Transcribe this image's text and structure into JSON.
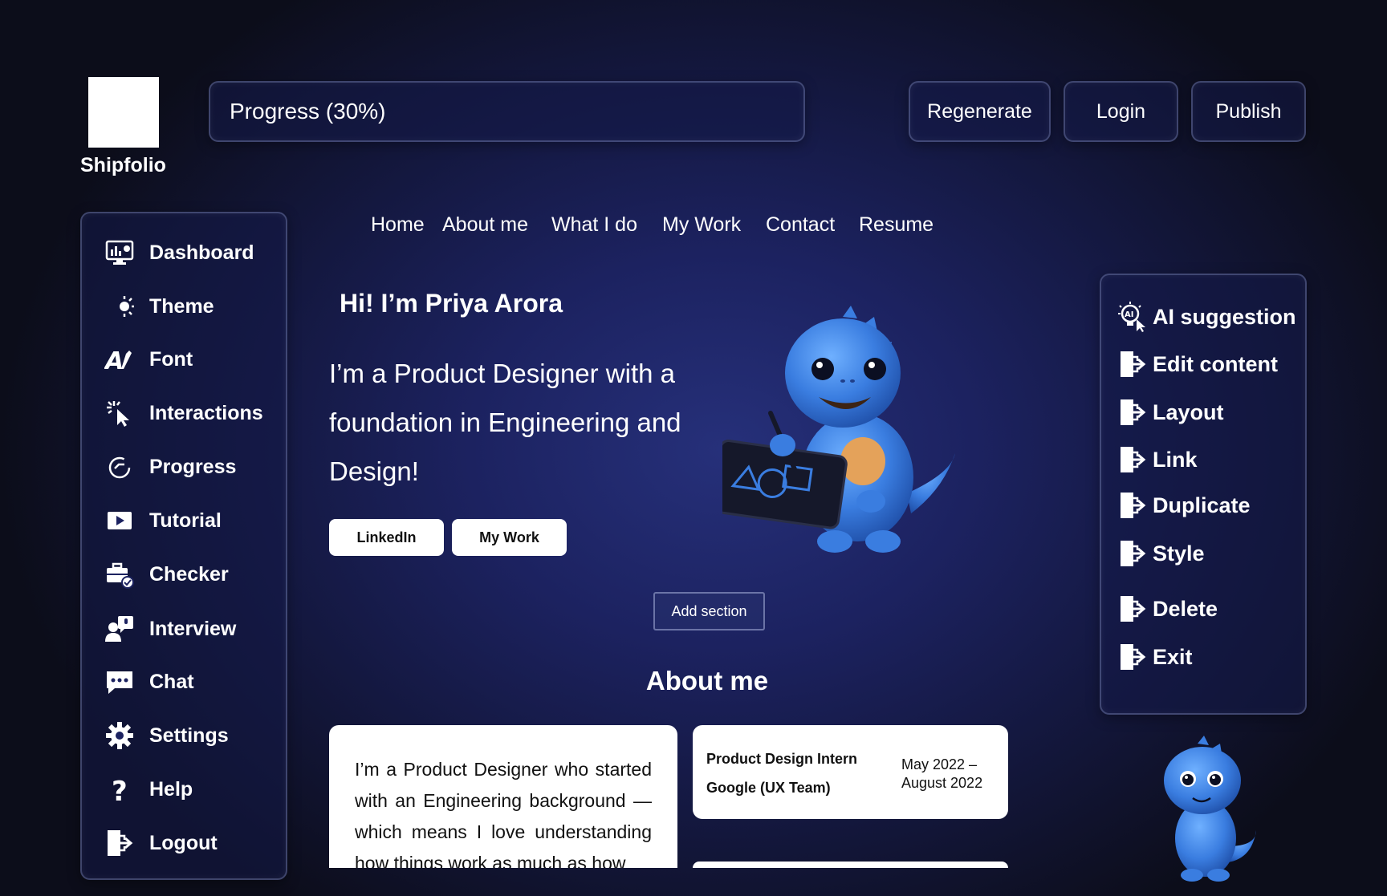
{
  "brand": {
    "name": "Shipfolio"
  },
  "header": {
    "progress_label": "Progress (30%)",
    "progress_value": 0.3,
    "regenerate": "Regenerate",
    "login": "Login",
    "publish": "Publish"
  },
  "sidebar": {
    "items": [
      {
        "label": "Dashboard",
        "icon": "dashboard-icon"
      },
      {
        "label": "Theme",
        "icon": "theme-icon"
      },
      {
        "label": "Font",
        "icon": "font-icon"
      },
      {
        "label": "Interactions",
        "icon": "interactions-icon"
      },
      {
        "label": "Progress",
        "icon": "progress-icon"
      },
      {
        "label": "Tutorial",
        "icon": "tutorial-icon"
      },
      {
        "label": "Checker",
        "icon": "checker-icon"
      },
      {
        "label": "Interview",
        "icon": "interview-icon"
      },
      {
        "label": "Chat",
        "icon": "chat-icon"
      },
      {
        "label": "Settings",
        "icon": "settings-icon"
      },
      {
        "label": "Help",
        "icon": "help-icon"
      },
      {
        "label": "Logout",
        "icon": "logout-icon"
      }
    ]
  },
  "nav": {
    "items": [
      "Home",
      "About me",
      "What I do",
      "My Work",
      "Contact",
      "Resume"
    ]
  },
  "hero": {
    "title": "Hi! I’m Priya Arora",
    "subtitle": "I’m a Product Designer with a foundation in Engineering and Design!",
    "linkedin": "LinkedIn",
    "mywork": "My Work"
  },
  "add_section": "Add section",
  "about": {
    "title": "About me",
    "text": "I’m a Product Designer who started with an Engineering background — which means I love understanding how things work as much as how",
    "experience": {
      "role": "Product Design Intern",
      "company": "Google (UX Team)",
      "date": "May 2022 – August 2022"
    }
  },
  "right_panel": {
    "items": [
      {
        "label": "AI suggestion",
        "icon": "ai-suggestion-icon"
      },
      {
        "label": "Edit content",
        "icon": "edit-content-icon"
      },
      {
        "label": "Layout",
        "icon": "layout-icon"
      },
      {
        "label": "Link",
        "icon": "link-icon"
      },
      {
        "label": "Duplicate",
        "icon": "duplicate-icon"
      },
      {
        "label": "Style",
        "icon": "style-icon"
      },
      {
        "label": "Delete",
        "icon": "delete-icon"
      },
      {
        "label": "Exit",
        "icon": "exit-icon"
      }
    ]
  },
  "colors": {
    "background_center": "#26307a",
    "background_edge": "#0c0d1a",
    "mascot_blue": "#3a7de0"
  }
}
